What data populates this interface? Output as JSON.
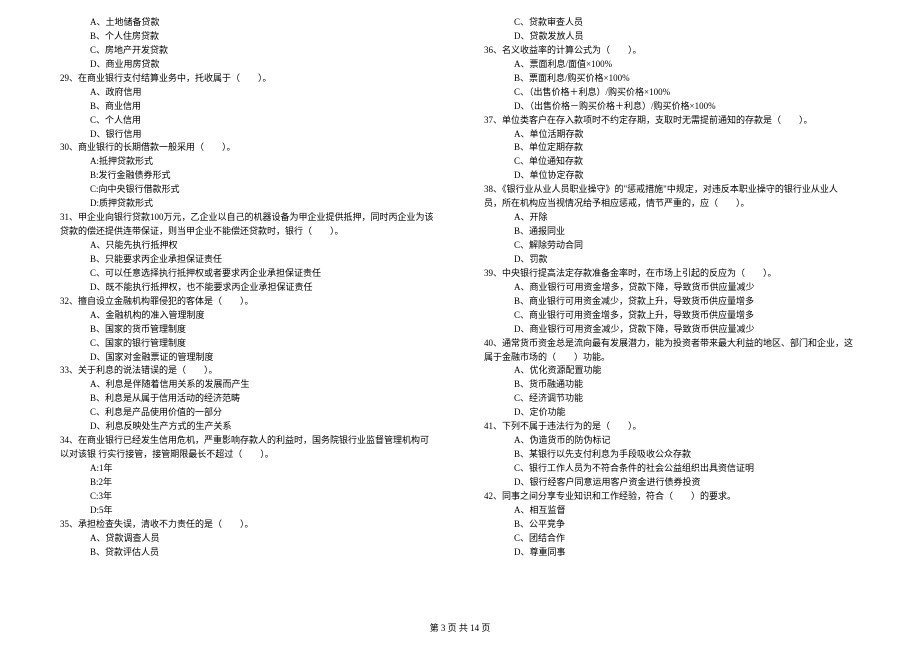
{
  "footer": "第 3 页 共 14 页",
  "left": {
    "q28_opts": [
      "A、土地储备贷款",
      "B、个人住房贷款",
      "C、房地产开发贷款",
      "D、商业用房贷款"
    ],
    "q29": "29、在商业银行支付结算业务中，托收属于（　　）。",
    "q29_opts": [
      "A、政府信用",
      "B、商业信用",
      "C、个人信用",
      "D、银行信用"
    ],
    "q30": "30、商业银行的长期借款一般采用（　　）。",
    "q30_opts": [
      "A:抵押贷款形式",
      "B:发行金融债券形式",
      "C:向中央银行借款形式",
      "D:质押贷款形式"
    ],
    "q31": "31、甲企业向银行贷款100万元，乙企业以自己的机器设备为甲企业提供抵押，同时丙企业为该",
    "q31_cont": "贷款的偿还提供连带保证，则当甲企业不能偿还贷款时，银行（　　）。",
    "q31_opts": [
      "A、只能先执行抵押权",
      "B、只能要求丙企业承担保证责任",
      "C、可以任意选择执行抵押权或者要求丙企业承担保证责任",
      "D、既不能执行抵押权，也不能要求丙企业承担保证责任"
    ],
    "q32": "32、擅自设立金融机构罪侵犯的客体是（　　）。",
    "q32_opts": [
      "A、金融机构的准入管理制度",
      "B、国家的货币管理制度",
      "C、国家的银行管理制度",
      "D、国家对金融票证的管理制度"
    ],
    "q33": "33、关于利息的说法错误的是（　　）。",
    "q33_opts": [
      "A、利息是伴随着信用关系的发展而产生",
      "B、利息是从属于信用活动的经济范畴",
      "C、利息是产品使用价值的一部分",
      "D、利息反映处生产方式的生产关系"
    ],
    "q34": "34、在商业银行已经发生信用危机，严重影响存款人的利益时，国务院银行业监督管理机构可",
    "q34_cont": "以对该银 行实行接管，接管期限最长不超过（　　）。",
    "q34_opts": [
      "A:1年",
      "B:2年",
      "C:3年",
      "D:5年"
    ],
    "q35": "35、承担检查失误，清收不力责任的是（　　）。",
    "q35_opts": [
      "A、贷款调查人员",
      "B、贷款评估人员"
    ]
  },
  "right": {
    "q35_opts_cont": [
      "C、贷款审查人员",
      "D、贷款发放人员"
    ],
    "q36": "36、名义收益率的计算公式为（　　）。",
    "q36_opts": [
      "A、票面利息/面值×100%",
      "B、票面利息/购买价格×100%",
      "C、（出售价格＋利息）/购买价格×100%",
      "D、（出售价格－购买价格＋利息）/购买价格×100%"
    ],
    "q37": "37、单位类客户在存入款项时不约定存期，支取时无需提前通知的存款是（　　）。",
    "q37_opts": [
      "A、单位活期存款",
      "B、单位定期存款",
      "C、单位通知存款",
      "D、单位协定存款"
    ],
    "q38": "38、《银行业从业人员职业操守》的\"惩戒措施\"中规定，对违反本职业操守的银行业从业人",
    "q38_cont": "员，所在机构应当视情况给予相应惩戒，情节严重的，应（　　）。",
    "q38_opts": [
      "A、开除",
      "B、通报同业",
      "C、解除劳动合同",
      "D、罚款"
    ],
    "q39": "39、中央银行提高法定存款准备金率时，在市场上引起的反应为（　　）。",
    "q39_opts": [
      "A、商业银行可用资金增多，贷款下降，导致货币供应量减少",
      "B、商业银行可用资金减少，贷款上升，导致货币供应量增多",
      "C、商业银行可用资金增多，贷款上升，导致货币供应量增多",
      "D、商业银行可用资金减少，贷款下降，导致货币供应量减少"
    ],
    "q40": "40、通常货币资金总是流向最有发展潜力，能为投资者带来最大利益的地区、部门和企业，这",
    "q40_cont": "属于金融市场的（　　）功能。",
    "q40_opts": [
      "A、优化资源配置功能",
      "B、货币融通功能",
      "C、经济调节功能",
      "D、定价功能"
    ],
    "q41": "41、下列不属于违法行为的是（　　）。",
    "q41_opts": [
      "A、伪造货币的防伪标记",
      "B、某银行以先支付利息为手段吸收公众存款",
      "C、银行工作人员为不符合条件的社会公益组织出具资信证明",
      "D、银行经客户同意运用客户资金进行债券投资"
    ],
    "q42": "42、同事之间分享专业知识和工作经验，符合（　　）的要求。",
    "q42_opts": [
      "A、相互监督",
      "B、公平竞争",
      "C、团结合作",
      "D、尊重同事"
    ]
  }
}
